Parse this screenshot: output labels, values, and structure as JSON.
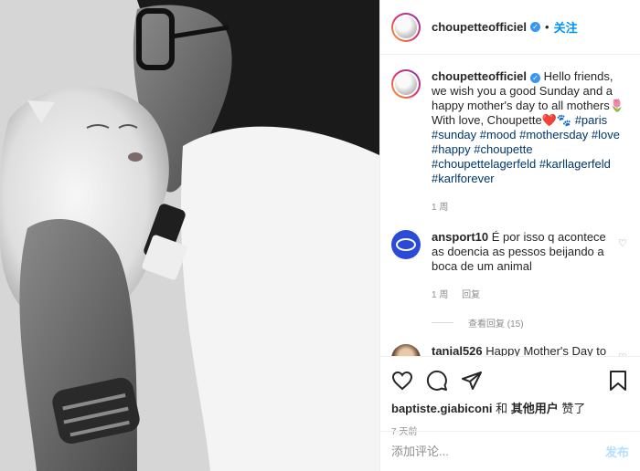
{
  "post": {
    "username": "choupetteofficiel",
    "follow_label": "关注",
    "separator": "•",
    "caption_text": "Hello friends, we wish you a good Sunday and a happy mother's day to all mothers🌷 With love, Choupette❤️🐾",
    "hashtags": "#paris #sunday #mood #mothersday #love #happy #choupette #choupettelagerfeld #karllagerfeld #karlforever",
    "caption_time": "1 周"
  },
  "comments": [
    {
      "username": "ansport10",
      "text": "É por isso q acontece as doencia as pessos beijando a boca de um animal",
      "time": "1 周",
      "reply_label": "回复",
      "view_replies": "查看回复 (15)"
    },
    {
      "username": "tanial526",
      "text": "Happy Mother's Day to"
    }
  ],
  "engagement": {
    "liked_by_user": "baptiste.giabiconi",
    "liked_conj": "和",
    "liked_others": "其他用户",
    "liked_suffix": "赞了",
    "date": "7 天前"
  },
  "comment_input": {
    "placeholder": "添加评论...",
    "post_label": "发布"
  },
  "colors": {
    "link_blue": "#0095f6",
    "hashtag": "#00376b",
    "muted": "#8e8e8e",
    "post_disabled": "#b2dffc"
  },
  "icons": [
    "heart-icon",
    "comment-icon",
    "share-icon",
    "bookmark-icon",
    "verified-icon"
  ]
}
